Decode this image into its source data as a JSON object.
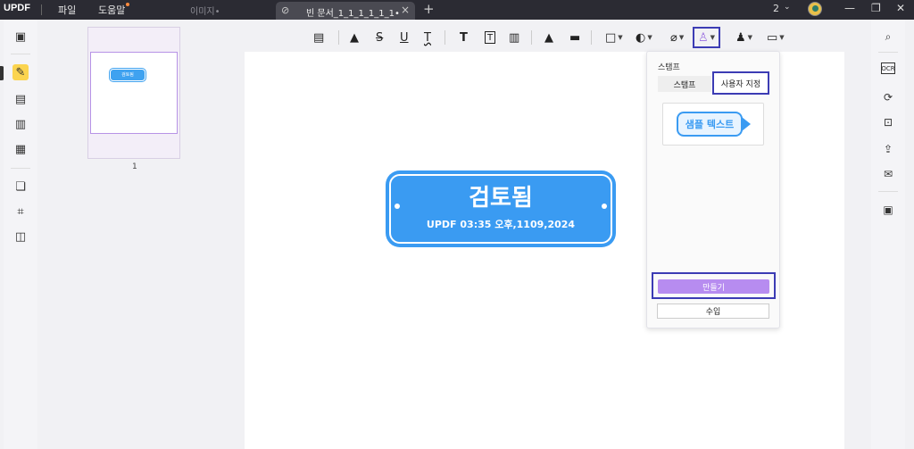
{
  "titlebar": {
    "logo": "UPDF",
    "menu": [
      "파일",
      "도움말"
    ],
    "inactive_tab": "이미지•",
    "active_tab": "빈 문서_1_1_1_1_1_1•",
    "new_tab_icon": "plus-icon",
    "page_count": "2",
    "window_controls": [
      "minimize-icon",
      "restore-icon",
      "close-icon"
    ]
  },
  "thumbnails": {
    "page_number": "1",
    "mini_stamp": "검토됨"
  },
  "toolbar": {
    "tools": [
      {
        "name": "comment-icon",
        "glyph": "▤"
      },
      {
        "name": "highlight-icon",
        "glyph": "▲"
      },
      {
        "name": "strikethrough-icon",
        "glyph": "S"
      },
      {
        "name": "underline-icon",
        "glyph": "U"
      },
      {
        "name": "squiggly-icon",
        "glyph": "T"
      },
      {
        "name": "text-icon",
        "glyph": "T"
      },
      {
        "name": "textbox-icon",
        "glyph": "T"
      },
      {
        "name": "sticky-note-icon",
        "glyph": "▥"
      },
      {
        "name": "pencil-icon",
        "glyph": "▲"
      },
      {
        "name": "eraser-icon",
        "glyph": "▬"
      },
      {
        "name": "shape-icon",
        "glyph": "□"
      },
      {
        "name": "color-icon",
        "glyph": "◐"
      },
      {
        "name": "attachment-icon",
        "glyph": "⌀"
      },
      {
        "name": "stamp-icon",
        "glyph": "♙"
      },
      {
        "name": "signature-icon",
        "glyph": "♟"
      },
      {
        "name": "measure-icon",
        "glyph": "▭"
      }
    ]
  },
  "document": {
    "stamp_title": "검토됨",
    "stamp_subtitle": "UPDF 03:35 오후,1109,2024",
    "stamp_color": "#3a9bf2"
  },
  "stamp_panel": {
    "title": "스탬프",
    "tab_stamps": "스탬프",
    "tab_custom": "사용자 지정",
    "sample_text": "샘플 텍스트",
    "create_label": "만들기",
    "import_label": "수입",
    "create_color": "#b78cf0",
    "highlight_color": "#3c3cb4"
  },
  "sidebar_left": [
    "reader-icon",
    "comment-mode-icon",
    "edit-icon",
    "page-layout-icon",
    "form-icon",
    "organize-icon",
    "crop-icon",
    "layers-icon"
  ],
  "sidebar_right": [
    "search-icon",
    "ocr-icon",
    "convert-icon",
    "protect-icon",
    "share-icon",
    "email-icon",
    "save-icon"
  ]
}
